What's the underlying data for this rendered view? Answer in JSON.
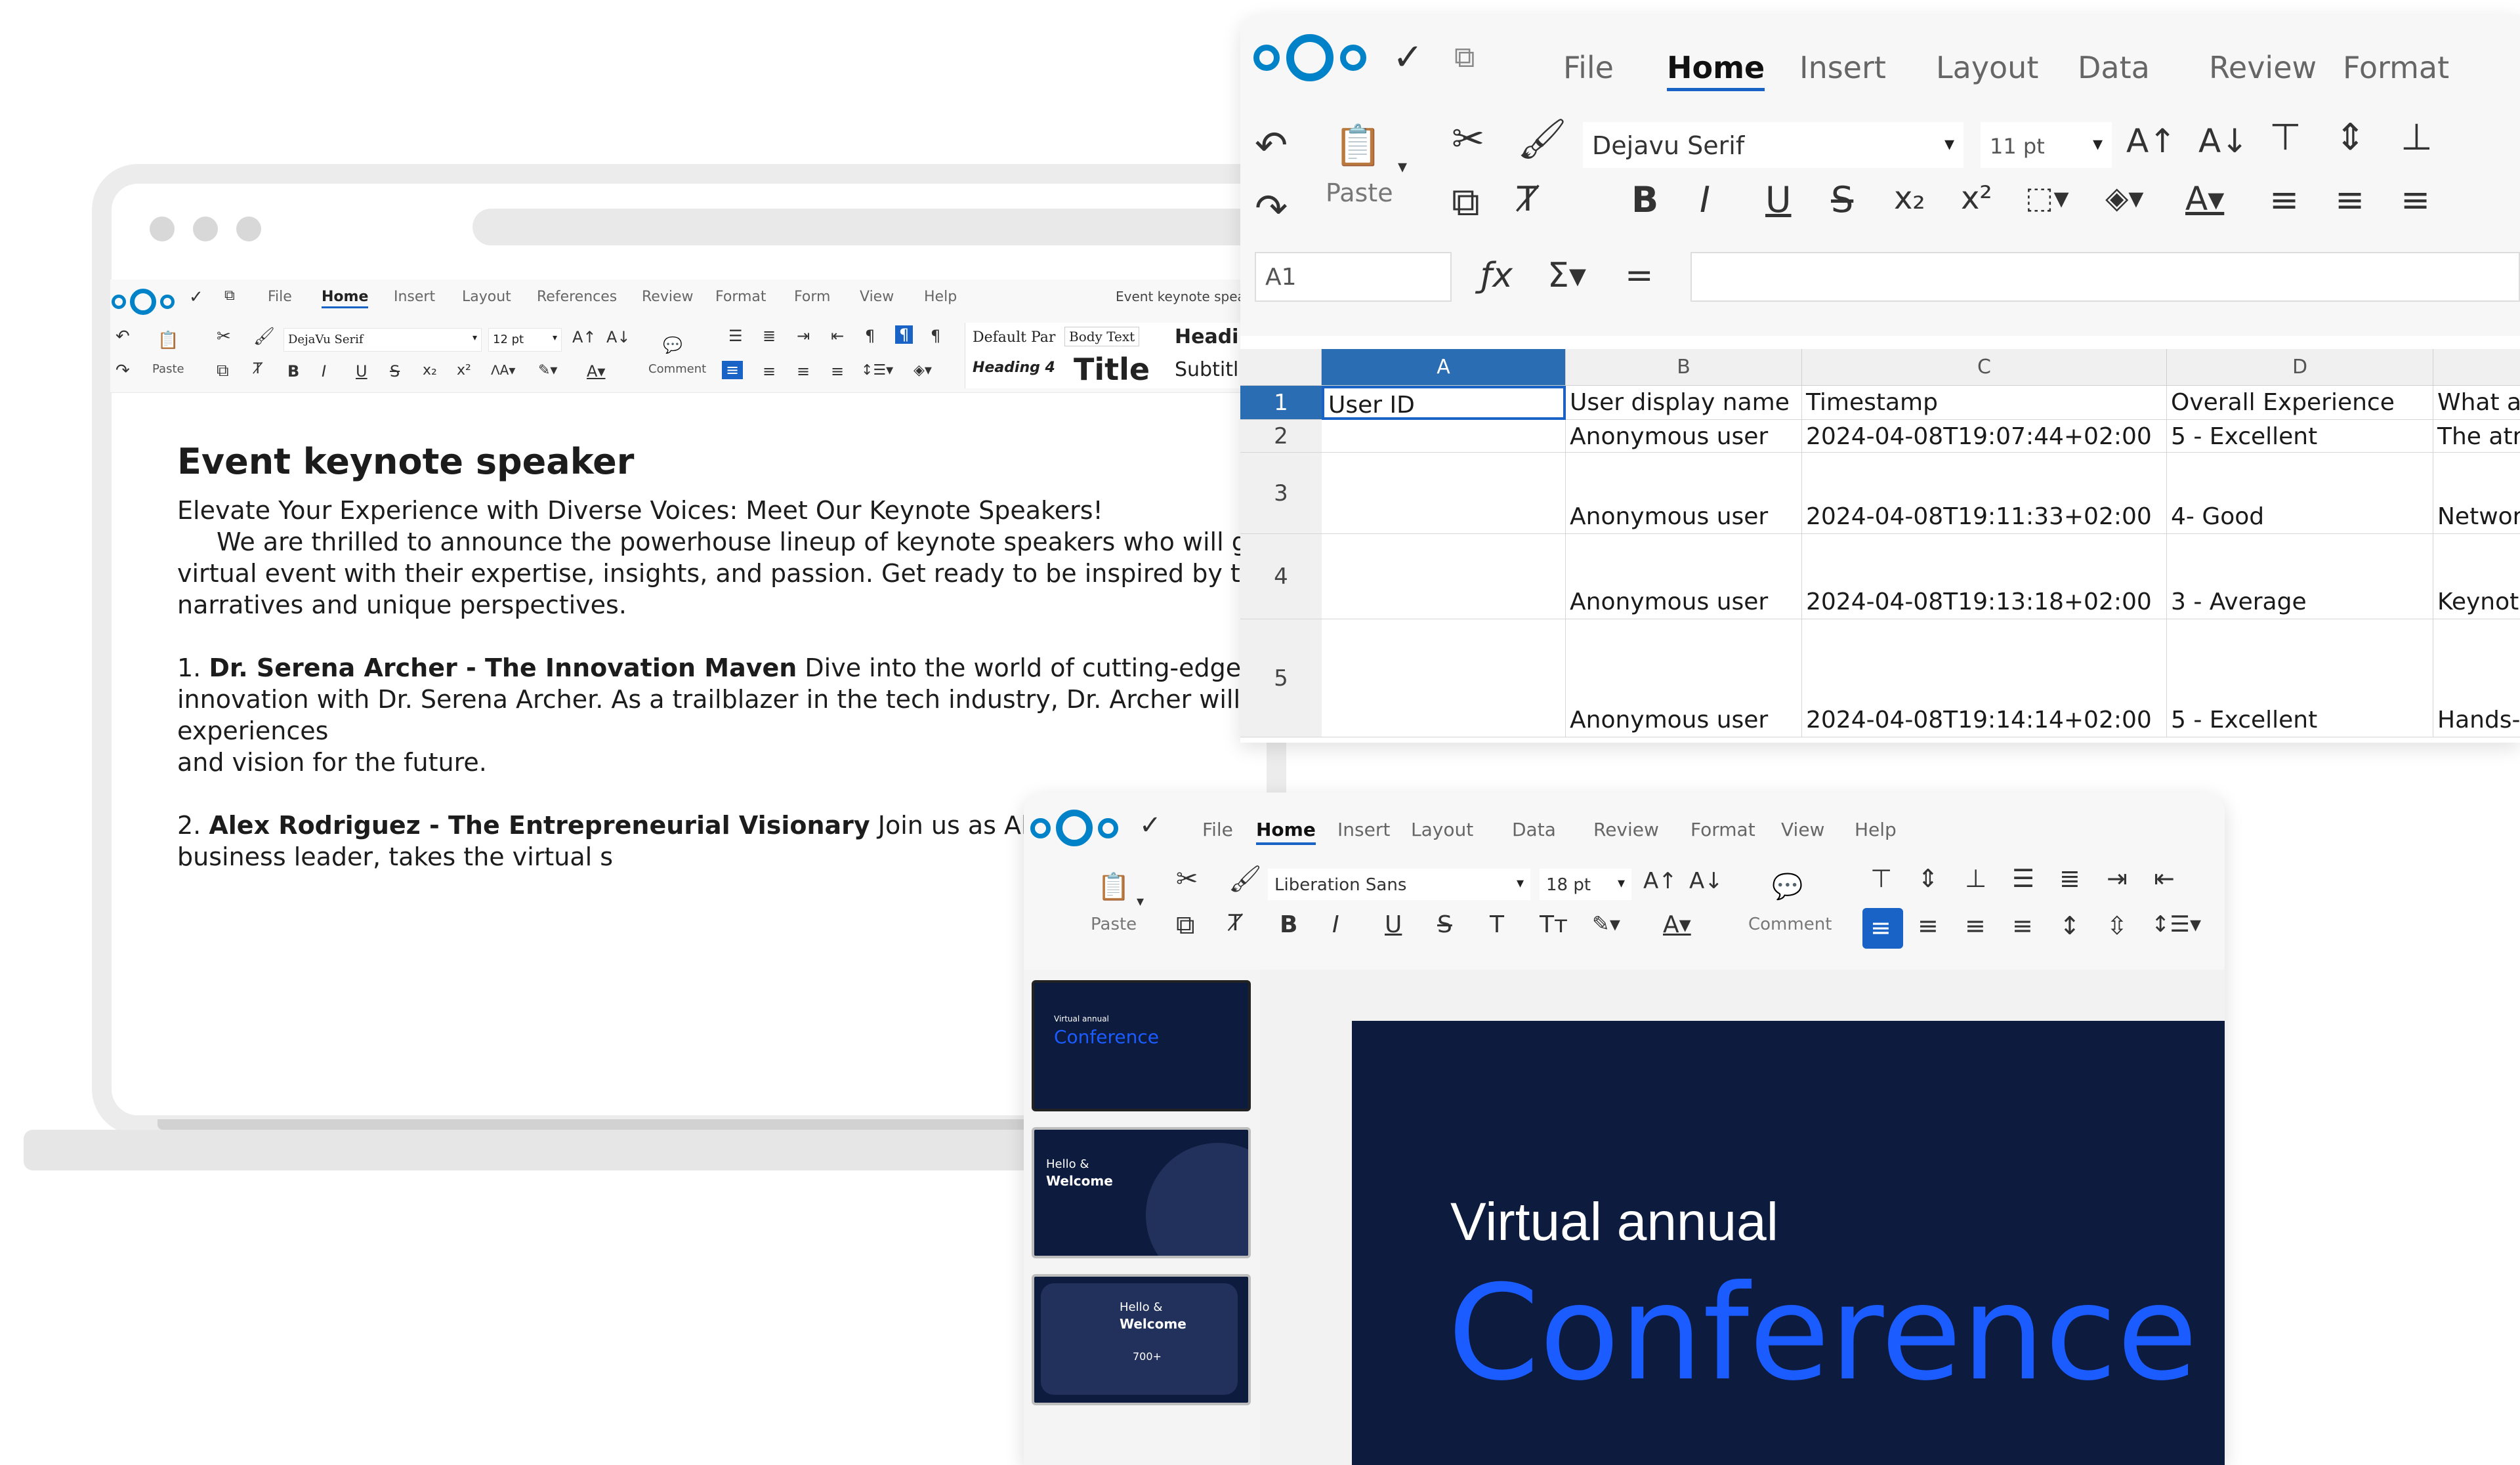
{
  "writer": {
    "menu": [
      "File",
      "Home",
      "Insert",
      "Layout",
      "References",
      "Review",
      "Format",
      "Form",
      "View",
      "Help"
    ],
    "active_menu": "Home",
    "doc_name": "Event keynote speak",
    "font_name": "DejaVu Serif",
    "font_size": "12 pt",
    "paste_label": "Paste",
    "comment_label": "Comment",
    "styles": {
      "default_par": "Default Par",
      "body_text": "Body Text",
      "heading_short": "Headi",
      "heading4": "Heading 4",
      "title": "Title",
      "subtitle": "Subtitl"
    },
    "document": {
      "title": "Event keynote speaker",
      "intro": "Elevate Your Experience with Diverse Voices: Meet Our Keynote Speakers!",
      "para1_line1": "We are thrilled to announce the powerhouse lineup of keynote speakers who will gra",
      "para1_line2": "virtual event with their expertise, insights, and passion. Get ready to be inspired by their",
      "para1_line3": "narratives and unique perspectives.",
      "item1_num": "1.",
      "item1_bold": "Dr. Serena Archer - The Innovation Maven",
      "item1_rest": "Dive into the world of cutting-edge tech",
      "item1_line2": "innovation with Dr. Serena Archer. As a trailblazer in the tech industry, Dr. Archer will share her experiences",
      "item1_line3": "and vision for the future.",
      "item2_num": "2.",
      "item2_bold": "Alex Rodriguez - The Entrepreneurial Visionary",
      "item2_rest": "Join us as Alex R",
      "item2_line2": "business leader, takes the virtual s"
    }
  },
  "calc": {
    "menu": [
      "File",
      "Home",
      "Insert",
      "Layout",
      "Data",
      "Review",
      "Format"
    ],
    "active_menu": "Home",
    "paste_label": "Paste",
    "font_name": "Dejavu Serif",
    "font_size": "11 pt",
    "cell_ref": "A1",
    "columns": [
      "A",
      "B",
      "C",
      "D"
    ],
    "rows": [
      {
        "num": "1",
        "cells": [
          "User ID",
          "User display name",
          "Timestamp",
          "Overall Experience",
          "What as"
        ]
      },
      {
        "num": "2",
        "cells": [
          "",
          "Anonymous user",
          "2024-04-08T19:07:44+02:00",
          "5 - Excellent",
          "The atm"
        ]
      },
      {
        "num": "3",
        "cells": [
          "",
          "Anonymous user",
          "2024-04-08T19:11:33+02:00",
          "4- Good",
          "Networl"
        ]
      },
      {
        "num": "4",
        "cells": [
          "",
          "Anonymous user",
          "2024-04-08T19:13:18+02:00",
          "3 - Average",
          "Keynote"
        ]
      },
      {
        "num": "5",
        "cells": [
          "",
          "Anonymous user",
          "2024-04-08T19:14:14+02:00",
          "5 - Excellent",
          "Hands-"
        ]
      }
    ]
  },
  "impress": {
    "menu": [
      "File",
      "Home",
      "Insert",
      "Layout",
      "Data",
      "Review",
      "Format",
      "View",
      "Help"
    ],
    "active_menu": "Home",
    "paste_label": "Paste",
    "comment_label": "Comment",
    "font_name": "Liberation Sans",
    "font_size": "18 pt",
    "slide": {
      "line1": "Virtual annual",
      "line2": "Conference"
    },
    "thumbs": {
      "t1_small": "Virtual annual",
      "t1_big": "Conference",
      "t2_hello": "Hello &",
      "t2_welcome": "Welcome",
      "t3_hello": "Hello &",
      "t3_welcome": "Welcome",
      "t3_num": "700+"
    }
  },
  "colors": {
    "brand_blue": "#0082c9",
    "slide_bg": "#0d1b3e",
    "conference_blue": "#1a5cff",
    "selection_blue": "#2a6db3"
  }
}
